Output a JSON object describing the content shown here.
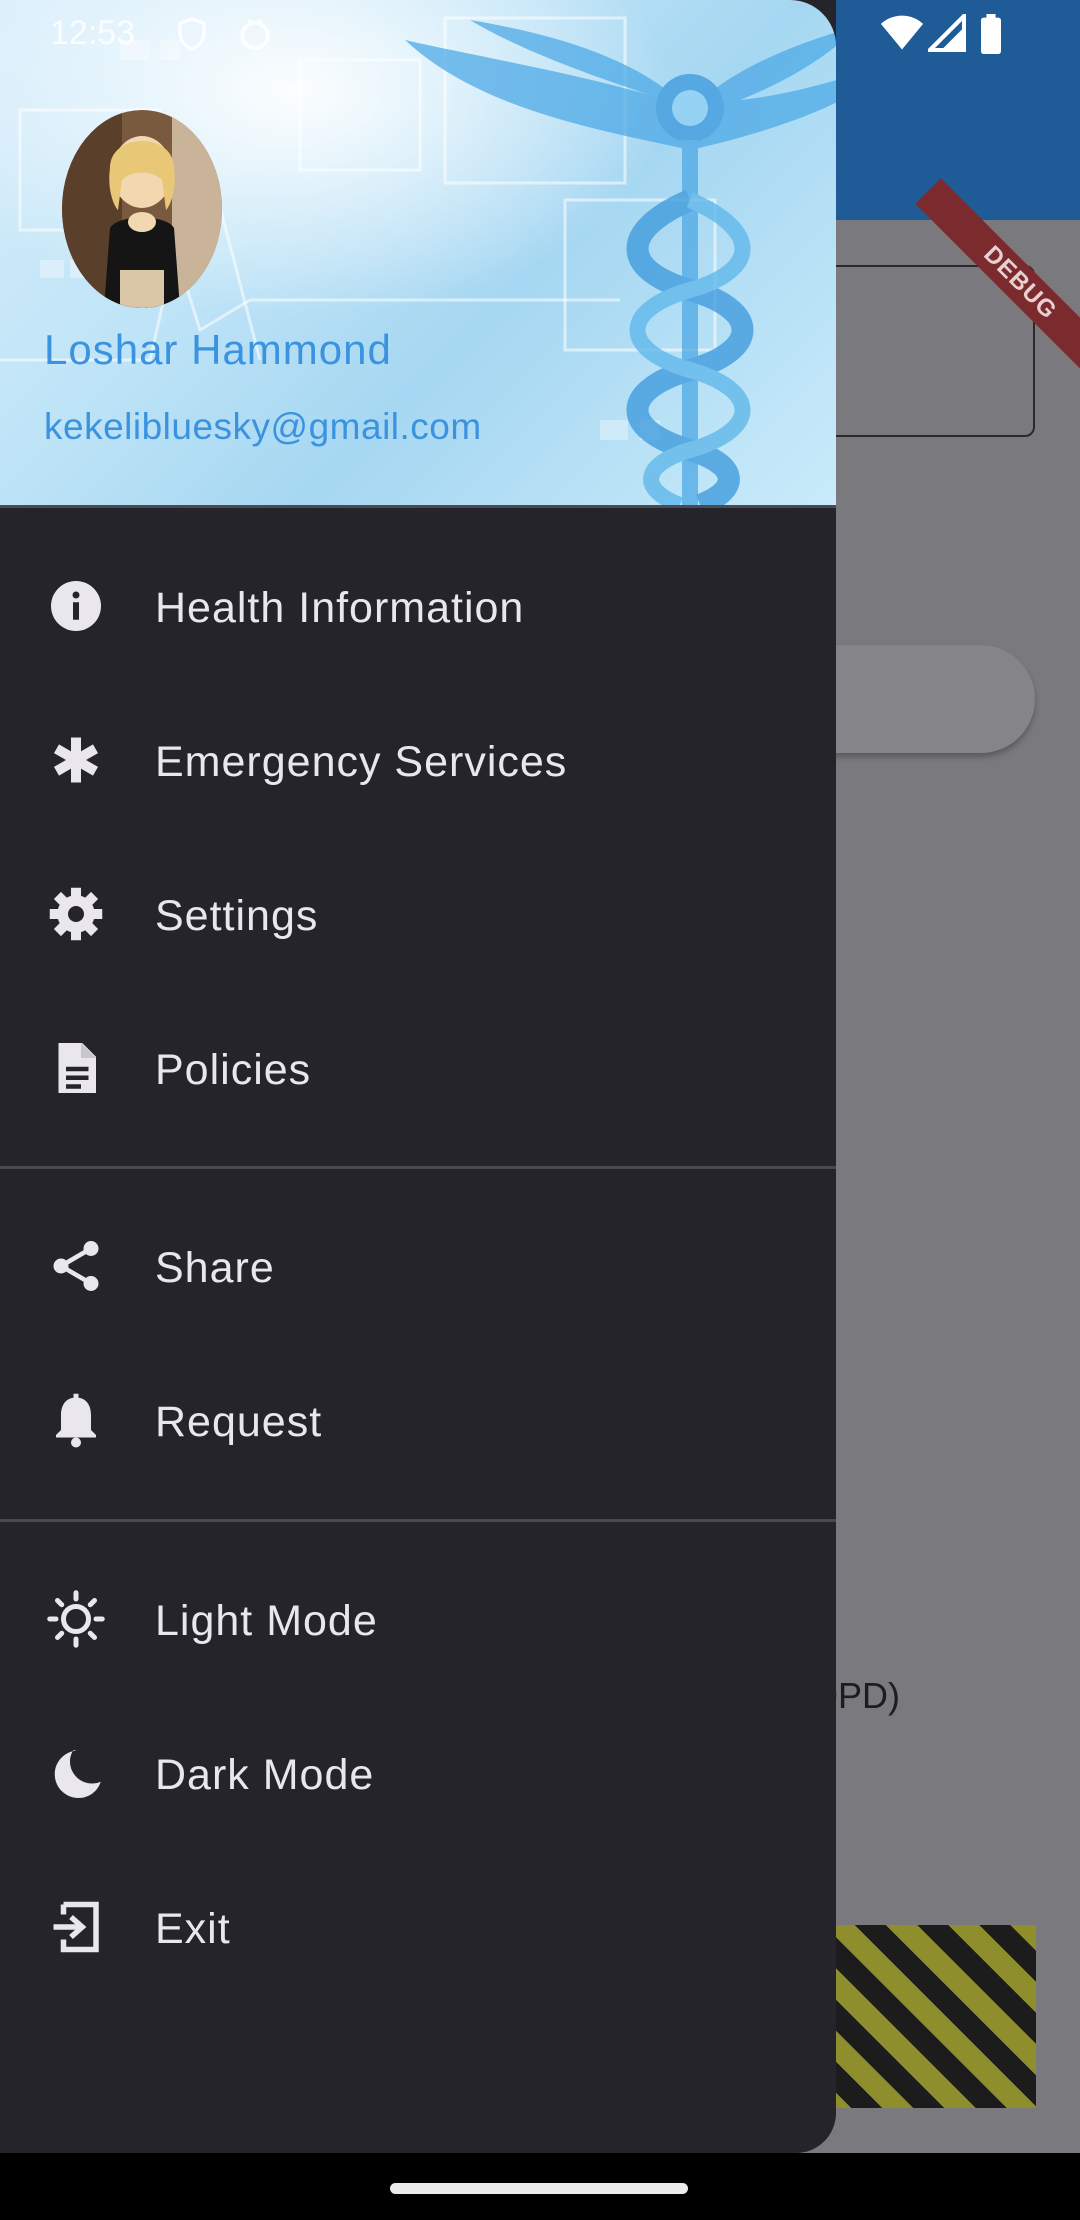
{
  "status_bar": {
    "time": "12:53"
  },
  "background": {
    "partial_text": "OPD)",
    "debug_banner": "DEBUG",
    "app_bar_color": "#1f5b96",
    "scrim_color": "#7a797d"
  },
  "drawer": {
    "header": {
      "user_name": "Loshar Hammond",
      "user_email": "kekelibluesky@gmail.com",
      "accent_color": "#3b93e0"
    },
    "sections": [
      [
        {
          "label": "Health Information",
          "icon": "info-icon"
        },
        {
          "label": "Emergency Services",
          "icon": "asterisk-icon"
        },
        {
          "label": "Settings",
          "icon": "gear-icon"
        },
        {
          "label": "Policies",
          "icon": "document-icon"
        }
      ],
      [
        {
          "label": "Share",
          "icon": "share-icon"
        },
        {
          "label": "Request",
          "icon": "bell-icon"
        }
      ],
      [
        {
          "label": "Light Mode",
          "icon": "sun-icon"
        },
        {
          "label": "Dark Mode",
          "icon": "moon-icon"
        },
        {
          "label": "Exit",
          "icon": "exit-icon"
        }
      ]
    ],
    "background_color": "#25242b",
    "text_color": "#e9e6ee"
  }
}
